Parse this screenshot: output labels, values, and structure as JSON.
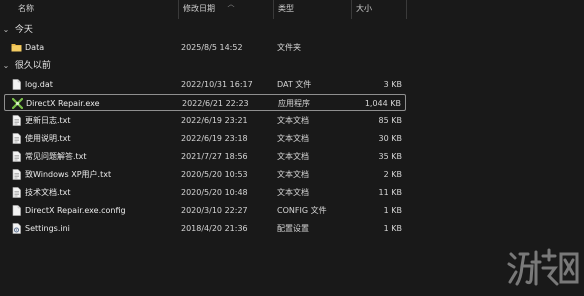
{
  "columns": {
    "name": "名称",
    "date": "修改日期",
    "type": "类型",
    "size": "大小"
  },
  "groups": {
    "today": "今天",
    "long_ago": "很久以前"
  },
  "files": [
    {
      "name": "Data",
      "date": "2025/8/5 14:52",
      "type": "文件夹",
      "size": "",
      "icon": "folder-icon"
    },
    {
      "name": "log.dat",
      "date": "2022/10/31 16:17",
      "type": "DAT 文件",
      "size": "3 KB",
      "icon": "file-icon"
    },
    {
      "name": "DirectX Repair.exe",
      "date": "2022/6/21 22:23",
      "type": "应用程序",
      "size": "1,044 KB",
      "icon": "directx-app-icon"
    },
    {
      "name": "更新日志.txt",
      "date": "2022/6/19 23:21",
      "type": "文本文档",
      "size": "85 KB",
      "icon": "text-file-icon"
    },
    {
      "name": "使用说明.txt",
      "date": "2022/6/19 23:18",
      "type": "文本文档",
      "size": "30 KB",
      "icon": "text-file-icon"
    },
    {
      "name": "常见问题解答.txt",
      "date": "2021/7/27 18:56",
      "type": "文本文档",
      "size": "35 KB",
      "icon": "text-file-icon"
    },
    {
      "name": "致Windows XP用户.txt",
      "date": "2020/5/20 10:53",
      "type": "文本文档",
      "size": "2 KB",
      "icon": "text-file-icon"
    },
    {
      "name": "技术文档.txt",
      "date": "2020/5/20 10:48",
      "type": "文本文档",
      "size": "11 KB",
      "icon": "text-file-icon"
    },
    {
      "name": "DirectX Repair.exe.config",
      "date": "2020/3/10 22:27",
      "type": "CONFIG 文件",
      "size": "1 KB",
      "icon": "config-file-icon"
    },
    {
      "name": "Settings.ini",
      "date": "2018/4/20 21:36",
      "type": "配置设置",
      "size": "1 KB",
      "icon": "settings-file-icon"
    }
  ],
  "watermark": {
    "text": "游侠网"
  },
  "colors": {
    "background": "#191919",
    "folder": "#e8b94a",
    "selection_border": "#8f8f8f"
  }
}
